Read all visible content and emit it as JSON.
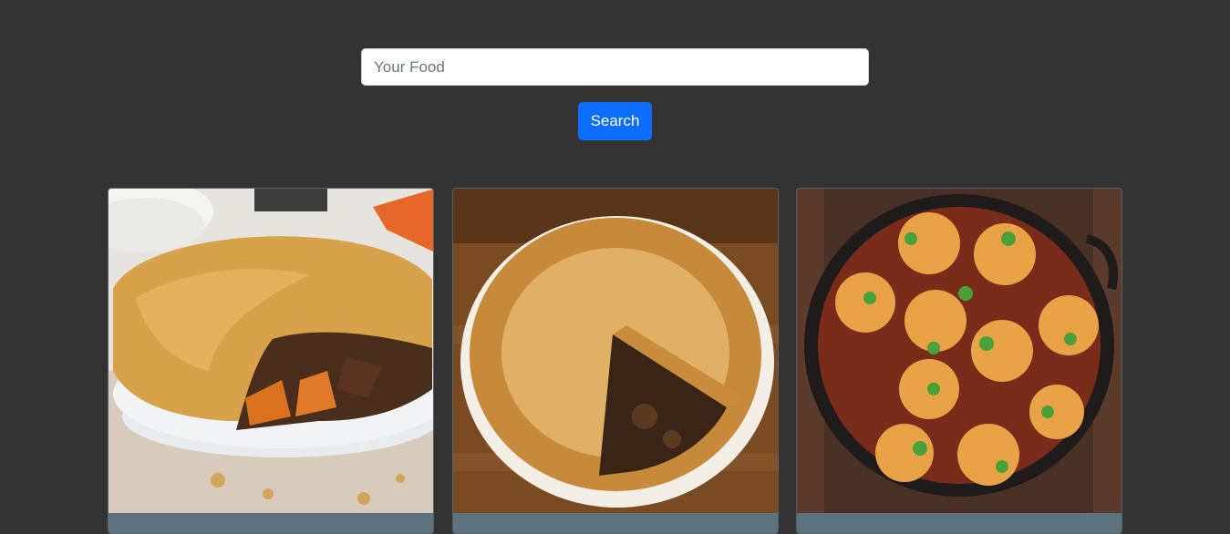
{
  "search": {
    "placeholder": "Your Food",
    "value": "",
    "button_label": "Search"
  },
  "colors": {
    "page_background": "#333333",
    "accent": "#0d6efd",
    "card_footer": "#5d7480"
  },
  "cards": [
    {
      "image": "steak-pie-slice-photo"
    },
    {
      "image": "pie-dish-cut-photo"
    },
    {
      "image": "stew-with-dumplings-photo"
    }
  ]
}
